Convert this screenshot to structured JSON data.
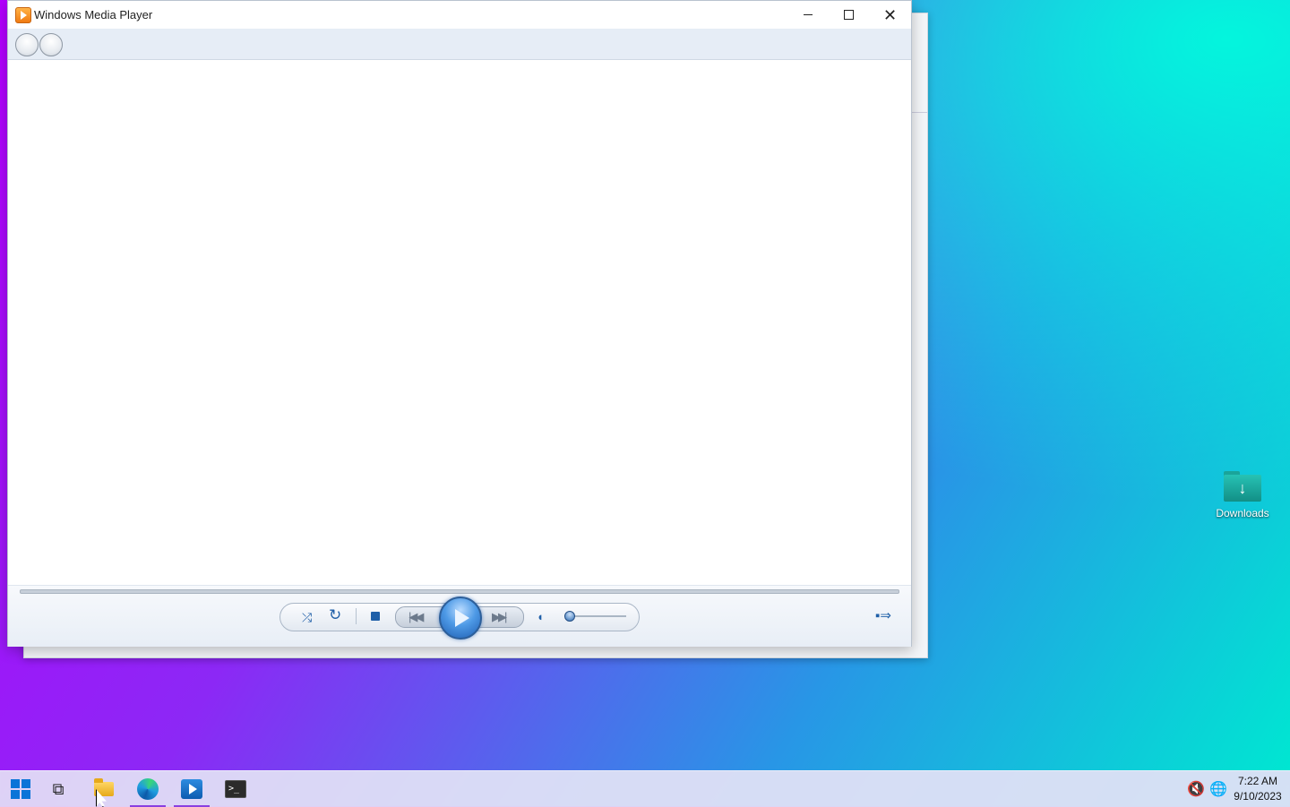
{
  "window": {
    "title": "Windows Media Player",
    "minimize_glyph": "",
    "maximize_glyph": "",
    "close_glyph": "✕"
  },
  "controls": {
    "shuffle_glyph": "⤮",
    "repeat_glyph": "↻",
    "previous_glyph": "|◀◀",
    "next_glyph": "▶▶|",
    "mute_glyph": "◖",
    "switch_layout_glyph": "▪⇒"
  },
  "desktop": {
    "icons": [
      {
        "label": "Downloads",
        "icon": "downloads-folder-icon"
      }
    ]
  },
  "taskbar": {
    "apps": [
      "start",
      "task-view",
      "file-explorer",
      "microsoft-edge",
      "windows-media-player",
      "terminal"
    ],
    "terminal_glyph": ">_",
    "taskview_glyph": "⧉",
    "tray": {
      "volume_glyph": "🔇",
      "network_glyph": "🌐"
    },
    "clock": {
      "time": "7:22 AM",
      "date": "9/10/2023"
    }
  },
  "colors": {
    "accent": "#1f5fa8",
    "taskbar_indicator": "#8a3fe0"
  }
}
